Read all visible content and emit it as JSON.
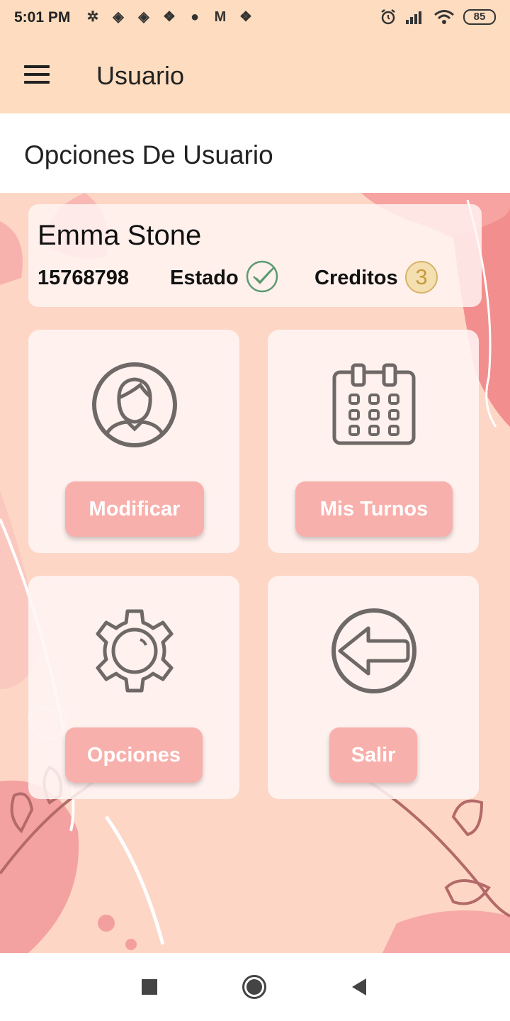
{
  "status_bar": {
    "time": "5:01 PM",
    "battery": "85",
    "icons": [
      "slack-icon",
      "app-icon",
      "app-icon",
      "dropbox-icon",
      "app-icon",
      "gmail-icon",
      "dropbox-icon",
      "alarm-icon",
      "signal-icon",
      "wifi-icon",
      "battery-icon"
    ]
  },
  "app_bar": {
    "title": "Usuario"
  },
  "section": {
    "title": "Opciones De Usuario"
  },
  "user": {
    "name": "Emma Stone",
    "id": "15768798",
    "estado_label": "Estado",
    "creditos_label": "Creditos",
    "creditos_value": "3"
  },
  "tiles": {
    "modificar": "Modificar",
    "turnos": "Mis Turnos",
    "opciones": "Opciones",
    "salir": "Salir"
  },
  "colors": {
    "app_bar": "#fddcbf",
    "button": "#f8b0ac",
    "icon": "#6e6966",
    "check": "#5a9a70",
    "credit_badge": "#f4dfb0"
  }
}
